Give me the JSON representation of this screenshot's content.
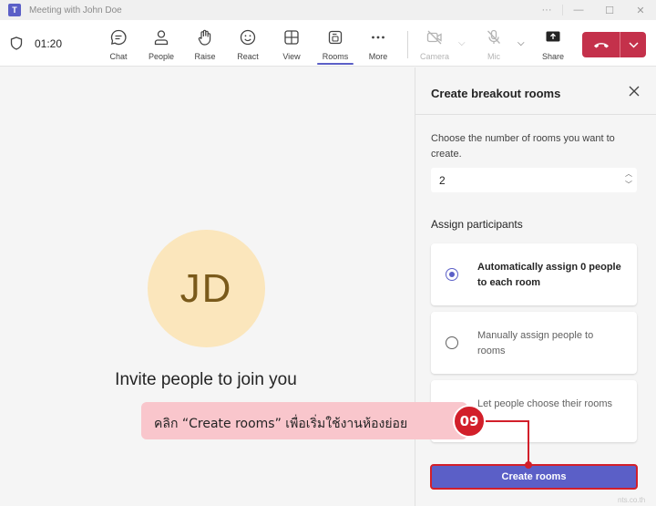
{
  "window": {
    "title": "Meeting with John Doe",
    "app_icon": "teams-icon"
  },
  "toolbar": {
    "timer": "01:20",
    "buttons": {
      "chat": "Chat",
      "people": "People",
      "raise": "Raise",
      "react": "React",
      "view": "View",
      "rooms": "Rooms",
      "more": "More",
      "camera": "Camera",
      "mic": "Mic",
      "share": "Share"
    },
    "active_tab": "Rooms",
    "leave_color": "#c4314b",
    "accent_color": "#5b5fc7"
  },
  "stage": {
    "avatar_initials": "JD",
    "invite_text": "Invite people to join you"
  },
  "panel": {
    "title": "Create breakout rooms",
    "rooms_prompt": "Choose the number of rooms you want to create.",
    "rooms_count": "2",
    "assign_label": "Assign participants",
    "options": [
      {
        "label": "Automatically assign 0 people to each room",
        "selected": true
      },
      {
        "label": "Manually assign people to rooms",
        "selected": false
      },
      {
        "label": "Let people choose their rooms",
        "selected": false
      }
    ],
    "create_button": "Create rooms"
  },
  "annotation": {
    "step": "09",
    "text": "คลิก “Create rooms” เพื่อเริ่มใช้งานห้องย่อย",
    "highlight_color": "#d21f2a"
  },
  "watermark": "nts.co.th"
}
